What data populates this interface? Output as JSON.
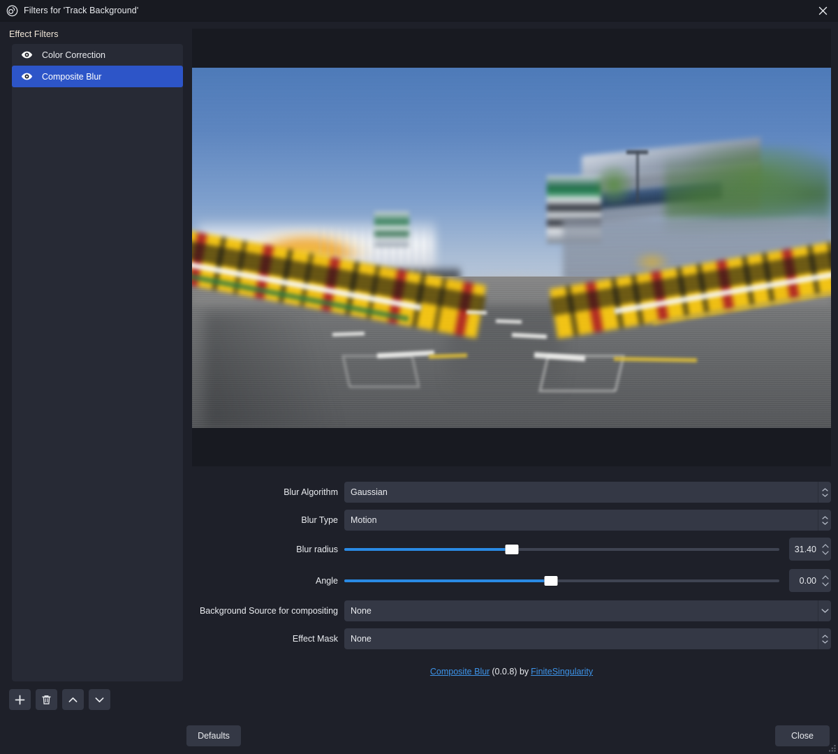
{
  "window": {
    "title": "Filters for 'Track Background'",
    "logo_icon": "obs-logo-icon",
    "close_icon": "close-icon"
  },
  "sidebar": {
    "section_title": "Effect Filters",
    "filters": [
      {
        "name": "Color Correction",
        "visibility_icon": "eye-icon",
        "selected": false
      },
      {
        "name": "Composite Blur",
        "visibility_icon": "eye-icon",
        "selected": true
      }
    ],
    "toolbar": {
      "add_icon": "plus-icon",
      "remove_icon": "trash-icon",
      "move_up_icon": "chevron-up-icon",
      "move_down_icon": "chevron-down-icon"
    }
  },
  "preview": {
    "description": "Motion-blurred racetrack straight with yellow Pirelli barriers, grandstands and blue sky"
  },
  "properties": [
    {
      "label": "Blur Algorithm",
      "type": "combobox",
      "value": "Gaussian",
      "arrows": "double"
    },
    {
      "label": "Blur Type",
      "type": "combobox",
      "value": "Motion",
      "arrows": "double"
    },
    {
      "label": "Blur radius",
      "type": "slider",
      "value": "31.40",
      "fill_percent": 38.5
    },
    {
      "label": "Angle",
      "type": "slider",
      "value": "0.00",
      "fill_percent": 47.5
    },
    {
      "label": "Background Source for compositing",
      "type": "combobox",
      "value": "None",
      "arrows": "single"
    },
    {
      "label": "Effect Mask",
      "type": "combobox",
      "value": "None",
      "arrows": "double"
    }
  ],
  "credit": {
    "plugin_name": "Composite Blur",
    "version": "(0.0.8) by",
    "author": "FiniteSingularity"
  },
  "footer": {
    "defaults_label": "Defaults",
    "close_label": "Close",
    "resize_grip_icon": "resize-grip-icon"
  },
  "colors": {
    "accent_blue": "#2d55c8",
    "slider_blue": "#2a8ae4",
    "link_blue": "#3d93e8",
    "panel_bg": "#1e2029",
    "titlebar_bg": "#181a21",
    "control_bg": "#343845",
    "list_bg": "#272a35"
  }
}
